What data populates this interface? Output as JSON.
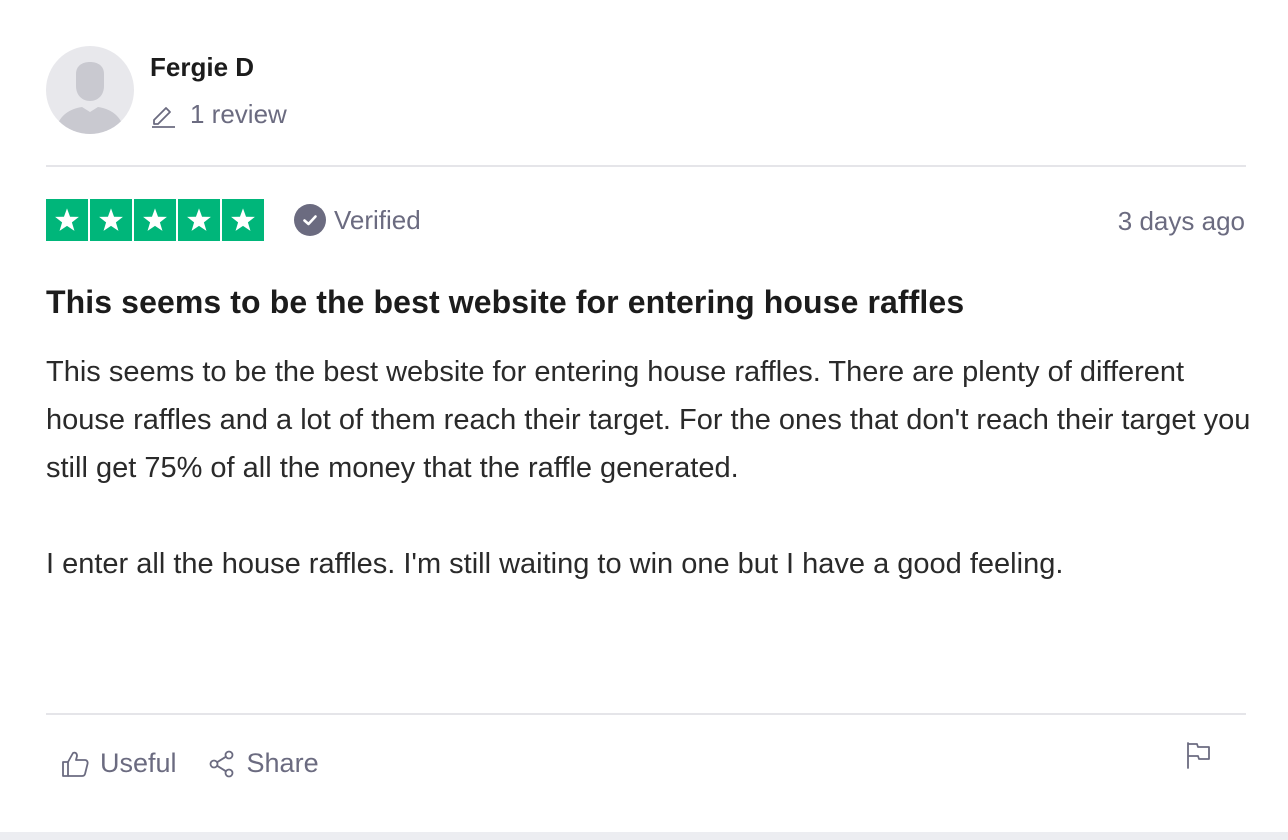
{
  "consumer": {
    "name": "Fergie D",
    "review_count": "1 review"
  },
  "rating": {
    "stars": 5,
    "max_stars": 5,
    "star_color": "#00b67a",
    "verified_label": "Verified",
    "date": "3 days ago"
  },
  "review": {
    "title": "This seems to be the best website for entering house raffles",
    "paragraphs": [
      "This seems to be the best website for entering house raffles. There are plenty of different house raffles and a lot of them reach their target. For the ones that don't reach their target you still get 75% of all the money that the raffle generated.",
      "I enter all the house raffles. I'm still waiting to win one but I have a good feeling."
    ]
  },
  "actions": {
    "useful_label": "Useful",
    "share_label": "Share",
    "icons": [
      "thumbs-up-icon",
      "share-icon",
      "flag-icon"
    ]
  },
  "colors": {
    "muted_text": "#6b6b80",
    "divider": "#e5e5e9"
  }
}
